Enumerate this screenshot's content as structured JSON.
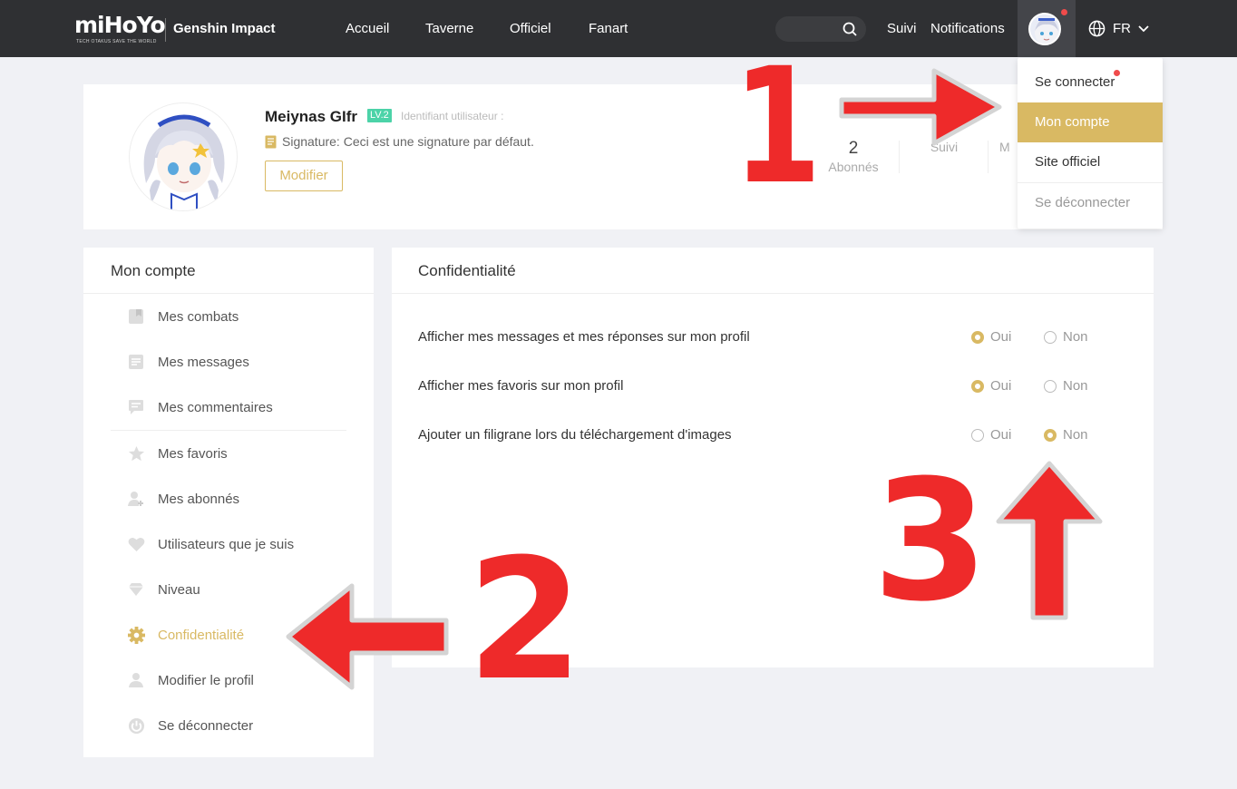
{
  "header": {
    "logo_text": "miHoYo",
    "logo_tagline": "TECH OTAKUS SAVE THE WORLD",
    "game_title": "Genshin Impact",
    "nav": [
      "Accueil",
      "Taverne",
      "Officiel",
      "Fanart"
    ],
    "right_links": {
      "suivi": "Suivi",
      "notifications": "Notifications"
    },
    "lang": "FR"
  },
  "dropdown": {
    "items": [
      "Se connecter",
      "Mon compte",
      "Site officiel",
      "Se déconnecter"
    ],
    "active_index": 1
  },
  "profile": {
    "name": "Meiynas GIfr",
    "level": "LV.2",
    "uid_label": "Identifiant utilisateur :",
    "signature": "Signature: Ceci est une signature par défaut.",
    "edit_button": "Modifier",
    "stats": [
      {
        "value": "2",
        "label": "Abonnés"
      },
      {
        "value": "",
        "label": "Suivi"
      },
      {
        "value": "",
        "label": "M"
      }
    ]
  },
  "sidebar": {
    "title": "Mon compte",
    "items": [
      {
        "label": "Mes combats",
        "icon": "bookmark-icon"
      },
      {
        "label": "Mes messages",
        "icon": "document-icon"
      },
      {
        "label": "Mes commentaires",
        "icon": "comment-icon"
      },
      {
        "label": "Mes favoris",
        "icon": "star-icon"
      },
      {
        "label": "Mes abonnés",
        "icon": "user-add-icon"
      },
      {
        "label": "Utilisateurs que je suis",
        "icon": "heart-icon"
      },
      {
        "label": "Niveau",
        "icon": "diamond-icon"
      },
      {
        "label": "Confidentialité",
        "icon": "gear-icon"
      },
      {
        "label": "Modifier le profil",
        "icon": "user-icon"
      },
      {
        "label": "Se déconnecter",
        "icon": "power-icon"
      }
    ],
    "active_index": 7
  },
  "privacy": {
    "title": "Confidentialité",
    "yes_label": "Oui",
    "no_label": "Non",
    "rows": [
      {
        "label": "Afficher mes messages et mes réponses sur mon profil",
        "selected": "Oui"
      },
      {
        "label": "Afficher mes favoris sur mon profil",
        "selected": "Oui"
      },
      {
        "label": "Ajouter un filigrane lors du téléchargement d'images",
        "selected": "Non"
      }
    ]
  },
  "annotations": {
    "step1": "1",
    "step2": "2",
    "step3": "3"
  },
  "colors": {
    "accent": "#d9b963",
    "topbar": "#2f3033",
    "annotation": "#ee2a2a",
    "badge": "#4cd3a8"
  }
}
